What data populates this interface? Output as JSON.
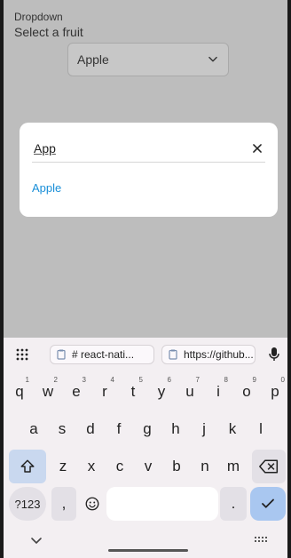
{
  "app": {
    "section_label": "Dropdown",
    "section_title": "Select a fruit",
    "dropdown_value": "Apple"
  },
  "modal": {
    "search_value": "App",
    "results": [
      "Apple"
    ]
  },
  "keyboard": {
    "chips": [
      "# react-nati...",
      "https://github..."
    ],
    "row1": [
      {
        "k": "q",
        "n": "1"
      },
      {
        "k": "w",
        "n": "2"
      },
      {
        "k": "e",
        "n": "3"
      },
      {
        "k": "r",
        "n": "4"
      },
      {
        "k": "t",
        "n": "5"
      },
      {
        "k": "y",
        "n": "6"
      },
      {
        "k": "u",
        "n": "7"
      },
      {
        "k": "i",
        "n": "8"
      },
      {
        "k": "o",
        "n": "9"
      },
      {
        "k": "p",
        "n": "0"
      }
    ],
    "row2": [
      "a",
      "s",
      "d",
      "f",
      "g",
      "h",
      "j",
      "k",
      "l"
    ],
    "row3": [
      "z",
      "x",
      "c",
      "v",
      "b",
      "n",
      "m"
    ],
    "symbols_label": "?123",
    "comma": ",",
    "period": "."
  },
  "colors": {
    "accent": "#1a8fd8",
    "keyboard_bg": "#f3eff2",
    "action_key": "#a9c7f0"
  }
}
